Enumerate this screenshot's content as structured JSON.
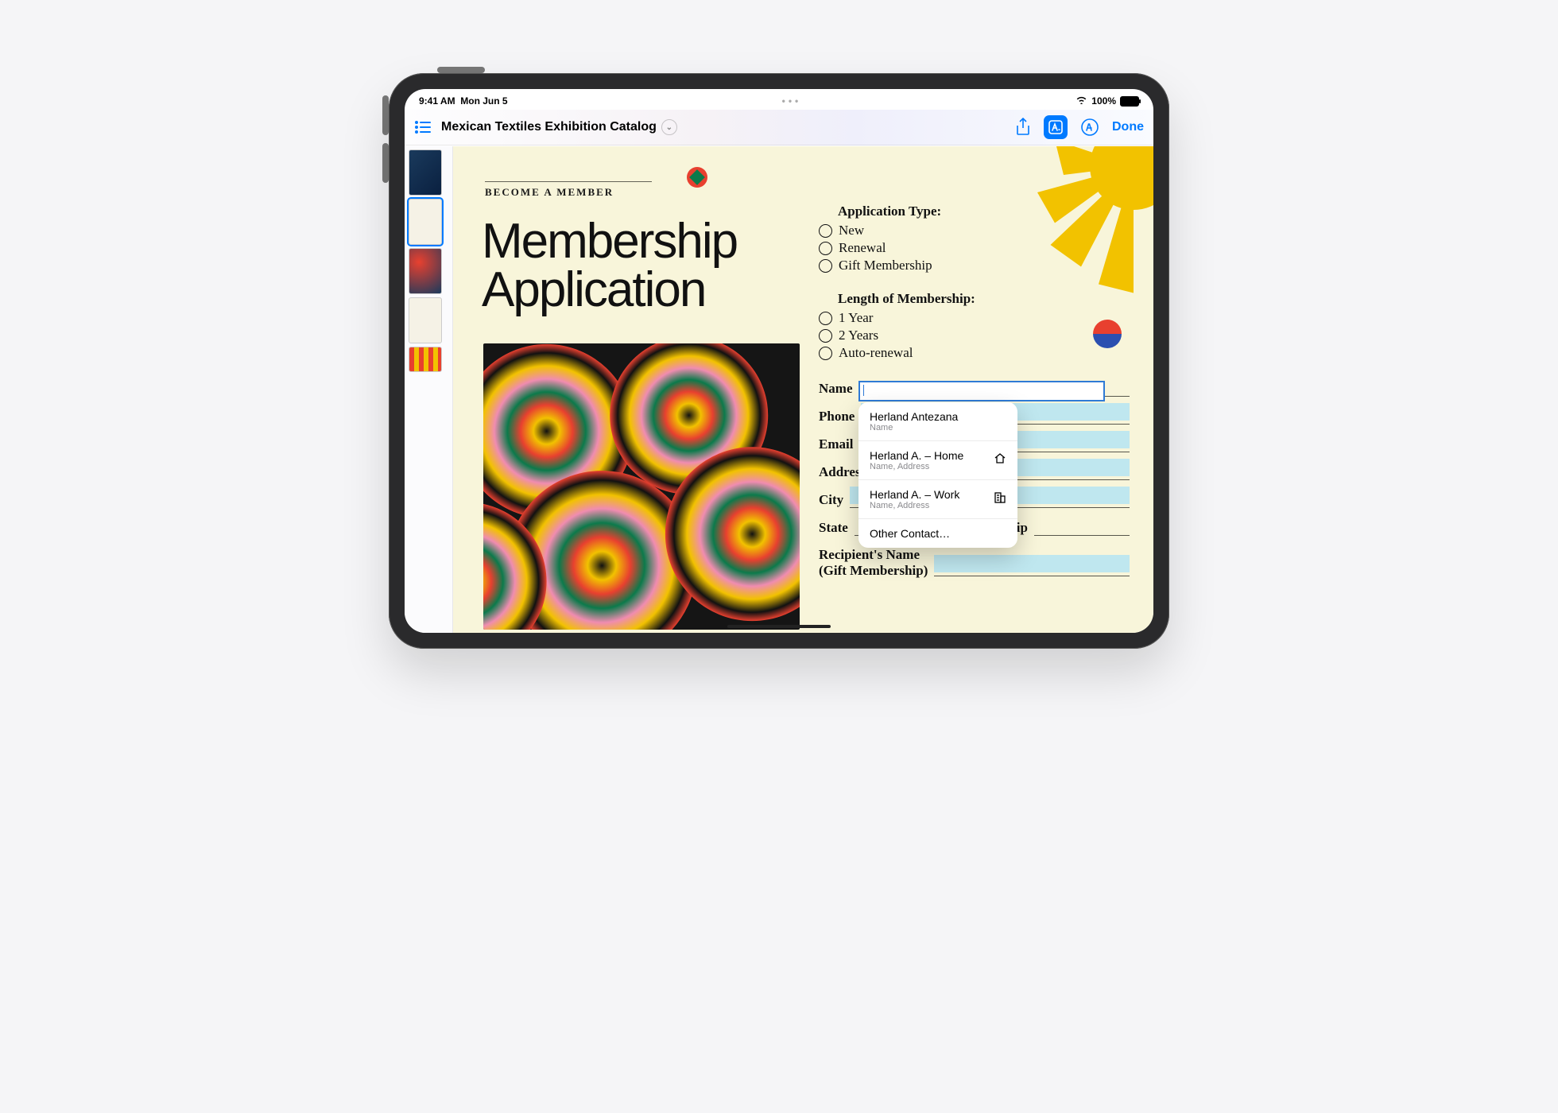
{
  "status": {
    "time": "9:41 AM",
    "date": "Mon Jun 5",
    "battery": "100%"
  },
  "toolbar": {
    "title": "Mexican Textiles Exhibition Catalog",
    "done": "Done"
  },
  "doc": {
    "kicker": "BECOME A MEMBER",
    "headline_l1": "Membership",
    "headline_l2": "Application",
    "appType": {
      "heading": "Application Type:",
      "opts": [
        "New",
        "Renewal",
        "Gift Membership"
      ]
    },
    "length": {
      "heading": "Length of Membership:",
      "opts": [
        "1 Year",
        "2 Years",
        "Auto-renewal"
      ]
    },
    "fields": {
      "name": "Name",
      "phone": "Phone",
      "email": "Email",
      "address": "Address",
      "city": "City",
      "state": "State",
      "zip": "Zip",
      "recipient1": "Recipient's Name",
      "recipient2": "(Gift Membership)"
    }
  },
  "autofill": {
    "r1": {
      "title": "Herland Antezana",
      "sub": "Name"
    },
    "r2": {
      "title": "Herland A. – Home",
      "sub": "Name, Address"
    },
    "r3": {
      "title": "Herland A. – Work",
      "sub": "Name, Address"
    },
    "other": "Other Contact…"
  }
}
